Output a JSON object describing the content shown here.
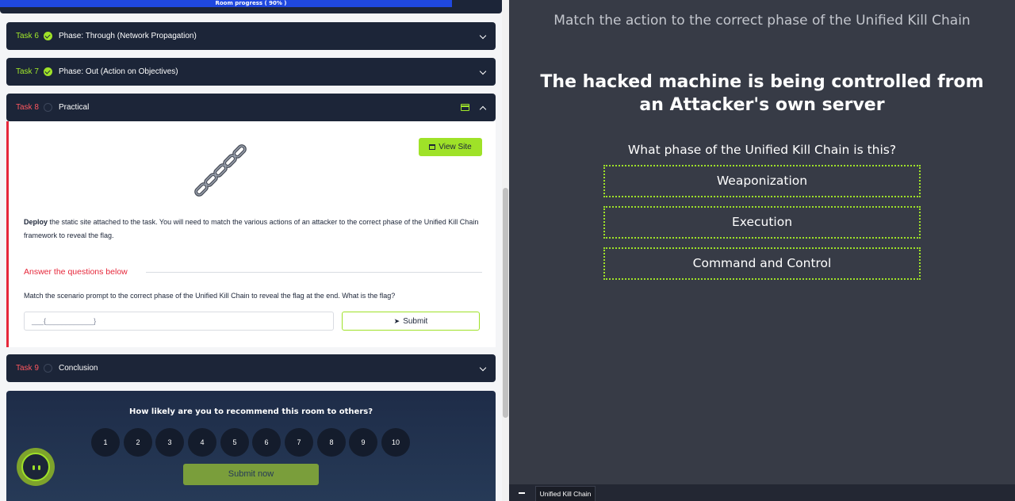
{
  "progress": {
    "label": "Room progress ( 90% )",
    "percent": 90
  },
  "tasks": [
    {
      "number": "Task 6",
      "title": "Phase: Through (Network Propagation)",
      "status": "complete"
    },
    {
      "number": "Task 7",
      "title": "Phase: Out (Action on Objectives)",
      "status": "complete"
    },
    {
      "number": "Task 8",
      "title": "Practical",
      "status": "incomplete"
    },
    {
      "number": "Task 9",
      "title": "Conclusion",
      "status": "incomplete"
    }
  ],
  "task8": {
    "view_site_label": "View Site",
    "description_bold": "Deploy",
    "description_rest": " the static site attached to the task. You will need to match the various actions of an attacker to the correct phase of the Unified Kill Chain framework to reveal the flag.",
    "answer_heading": "Answer the questions below",
    "question": "Match the scenario prompt to the correct phase of the Unified Kill Chain to reveal the flag at the end. What is the flag?",
    "answer_placeholder": "___{____________}",
    "submit_label": "Submit"
  },
  "recommend": {
    "title": "How likely are you to recommend this room to others?",
    "ratings": [
      "1",
      "2",
      "3",
      "4",
      "5",
      "6",
      "7",
      "8",
      "9",
      "10"
    ],
    "submit_label": "Submit now"
  },
  "quiz": {
    "header": "Match the action to the correct phase of the Unified Kill Chain",
    "scenario": "The hacked machine is being controlled from an Attacker's own server",
    "question": "What phase of the Unified Kill Chain is this?",
    "options": [
      "Weaponization",
      "Execution",
      "Command and Control"
    ]
  },
  "taskbar": {
    "tab_label": "Unified Kill Chain"
  },
  "colors": {
    "accent_green": "#9fe228",
    "accent_red": "#e6273a",
    "navy": "#1c2538",
    "progress_blue": "#1f48e0",
    "quiz_bg": "#373b46"
  },
  "icons": {
    "task_complete": "check-circle-icon",
    "task_incomplete": "empty-circle-icon",
    "expand": "chevron-down-icon",
    "collapse": "chevron-up-icon",
    "split_view": "split-view-icon",
    "view_site": "browser-window-icon",
    "submit": "paper-plane-icon",
    "illustration": "chain-link-icon",
    "assistant": "bot-avatar-icon"
  }
}
